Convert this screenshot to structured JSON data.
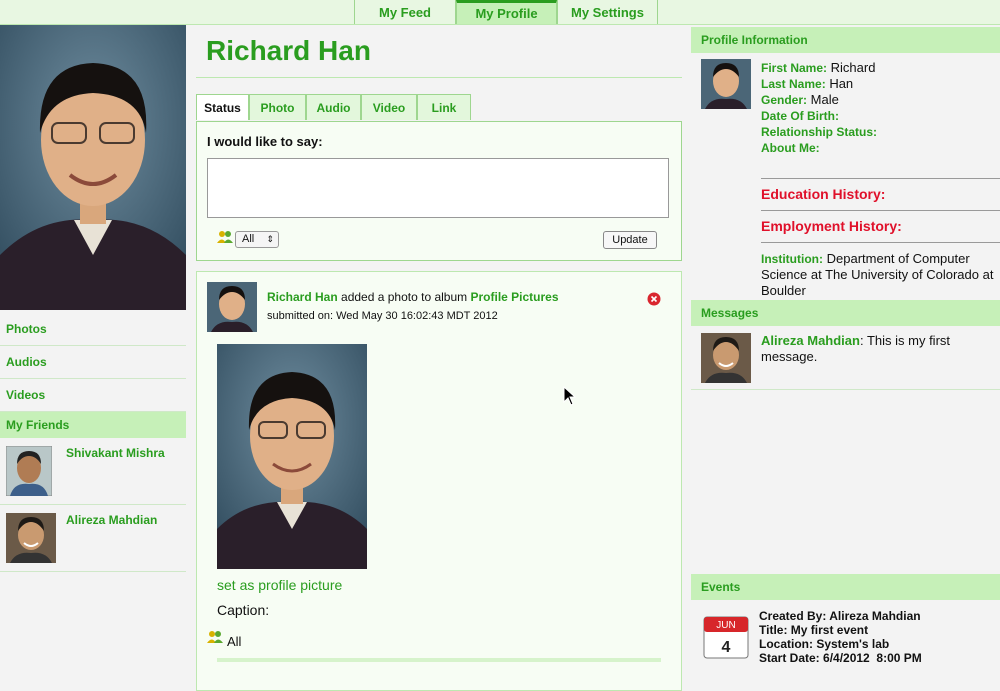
{
  "nav": {
    "tabs": [
      "My Feed",
      "My Profile",
      "My Settings"
    ],
    "active": "My Profile"
  },
  "left": {
    "links": [
      "Photos",
      "Audios",
      "Videos"
    ],
    "friends_header": "My Friends",
    "friends": [
      "Shivakant Mishra",
      "Alireza Mahdian"
    ]
  },
  "profile": {
    "name": "Richard Han",
    "tabs": [
      "Status",
      "Photo",
      "Audio",
      "Video",
      "Link"
    ],
    "status_prompt": "I would like to say:",
    "status_value": "",
    "privacy_value": "All",
    "update_label": "Update"
  },
  "feed": {
    "actor": "Richard Han",
    "action": "added a photo to album",
    "album": "Profile Pictures",
    "submitted": "submitted on: Wed May 30 16:02:43 MDT 2012",
    "set_profile": "set as profile picture",
    "caption": "Caption:",
    "privacy": "All"
  },
  "info": {
    "header": "Profile Information",
    "first_name_label": "First Name:",
    "first_name": "Richard",
    "last_name_label": "Last Name:",
    "last_name": "Han",
    "gender_label": "Gender:",
    "gender": "Male",
    "dob_label": "Date Of Birth:",
    "rel_label": "Relationship Status:",
    "about_label": "About Me:",
    "education": "Education History:",
    "employment": "Employment History:",
    "institution_label": "Institution:",
    "institution": "Department of Computer Science at The University of Colorado at Boulder"
  },
  "messages": {
    "header": "Messages",
    "from": "Alireza Mahdian",
    "text": ": This is my first message."
  },
  "events": {
    "header": "Events",
    "cal_month": "JUN",
    "cal_day": "4",
    "created_by": "Created By: Alireza Mahdian",
    "title": "Title: My first event",
    "location": "Location: System's lab",
    "start": "Start Date: 6/4/2012  8:00 PM"
  },
  "colors": {
    "accent": "#2a9d1f",
    "header_bg": "#c6f0b8",
    "alert": "#e0102a"
  }
}
